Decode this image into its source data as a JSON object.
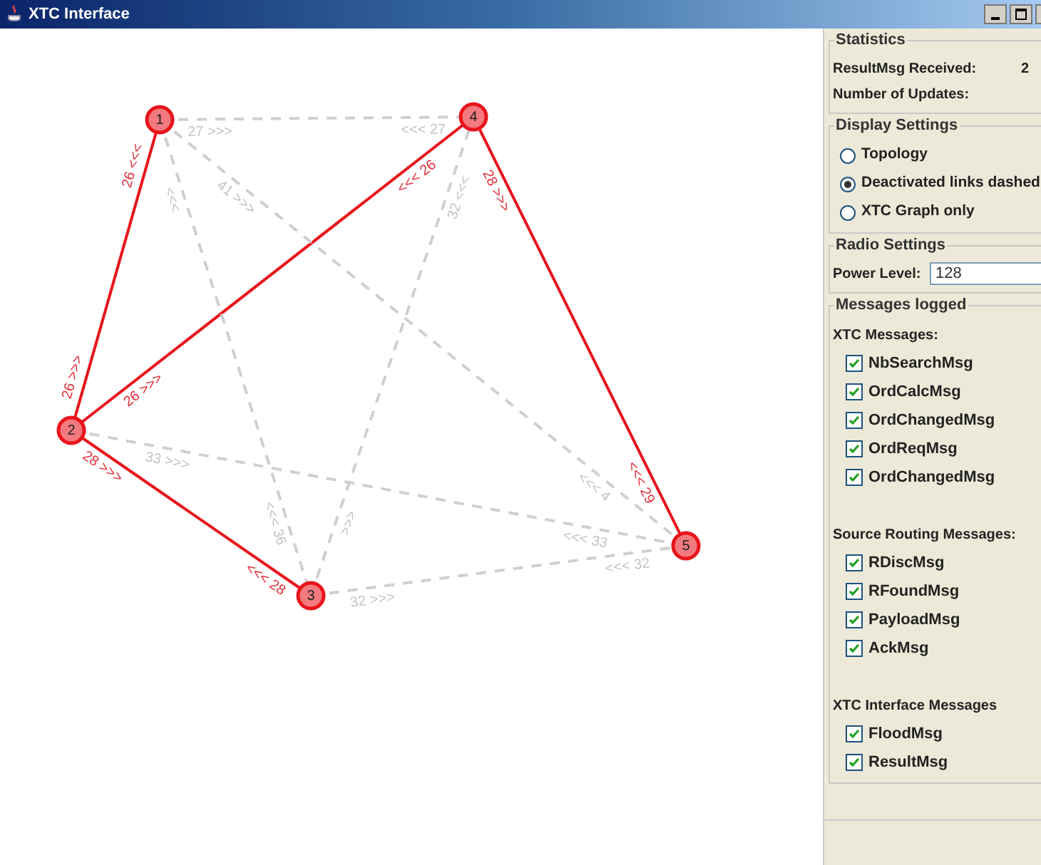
{
  "window": {
    "title": "XTC Interface"
  },
  "graph": {
    "nodes": [
      {
        "label": "1"
      },
      {
        "label": "2"
      },
      {
        "label": "3"
      },
      {
        "label": "4"
      },
      {
        "label": "5"
      }
    ],
    "edges": [
      {
        "active": false,
        "label_from": "27 >>>",
        "label_to": "<<< 27"
      },
      {
        "active": true,
        "label_from": "26 <<<",
        "label_to": "26 >>>"
      },
      {
        "active": true,
        "label_from": "26 >>>",
        "label_to": "<<< 26"
      },
      {
        "active": true,
        "label_from": "28 >>>",
        "label_to": "<<< 29"
      },
      {
        "active": true,
        "label_from": "28 >>>",
        "label_to": "<<< 28"
      },
      {
        "active": false,
        "label_from": "33 >>>",
        "label_to": "<<< 33"
      },
      {
        "active": false,
        "label_from": "32 >>>",
        "label_to": "<<< 32"
      },
      {
        "active": false,
        "label_from": "41 >>>",
        "label_to": "<<< 4"
      },
      {
        "active": false,
        "label_from": "<<<",
        "label_to": "<<< 36"
      },
      {
        "active": false,
        "label_from": ">>>",
        "label_to": "32 <<<"
      }
    ]
  },
  "statistics": {
    "title": "Statistics",
    "rows": [
      {
        "label": "ResultMsg Received:",
        "value": "2"
      },
      {
        "label": "Number of Updates:"
      }
    ]
  },
  "display_settings": {
    "title": "Display Settings",
    "options": [
      {
        "label": "Topology",
        "selected": false
      },
      {
        "label": "Deactivated links dashed",
        "selected": true
      },
      {
        "label": "XTC Graph only",
        "selected": false
      }
    ]
  },
  "radio_settings": {
    "title": "Radio Settings",
    "power_label": "Power Level:",
    "power_value": "128"
  },
  "messages_logged": {
    "title": "Messages logged",
    "groups": [
      {
        "title": "XTC Messages:",
        "items": [
          {
            "label": "NbSearchMsg",
            "checked": true
          },
          {
            "label": "OrdCalcMsg",
            "checked": true
          },
          {
            "label": "OrdChangedMsg",
            "checked": true
          },
          {
            "label": "OrdReqMsg",
            "checked": true
          },
          {
            "label": "OrdChangedMsg",
            "checked": true
          }
        ]
      },
      {
        "title": "Source Routing Messages:",
        "items": [
          {
            "label": "RDiscMsg",
            "checked": true
          },
          {
            "label": "RFoundMsg",
            "checked": true
          },
          {
            "label": "PayloadMsg",
            "checked": true
          },
          {
            "label": "AckMsg",
            "checked": true
          }
        ]
      },
      {
        "title": "XTC Interface Messages",
        "items": [
          {
            "label": "FloodMsg",
            "checked": true
          },
          {
            "label": "ResultMsg",
            "checked": true
          }
        ]
      }
    ]
  }
}
